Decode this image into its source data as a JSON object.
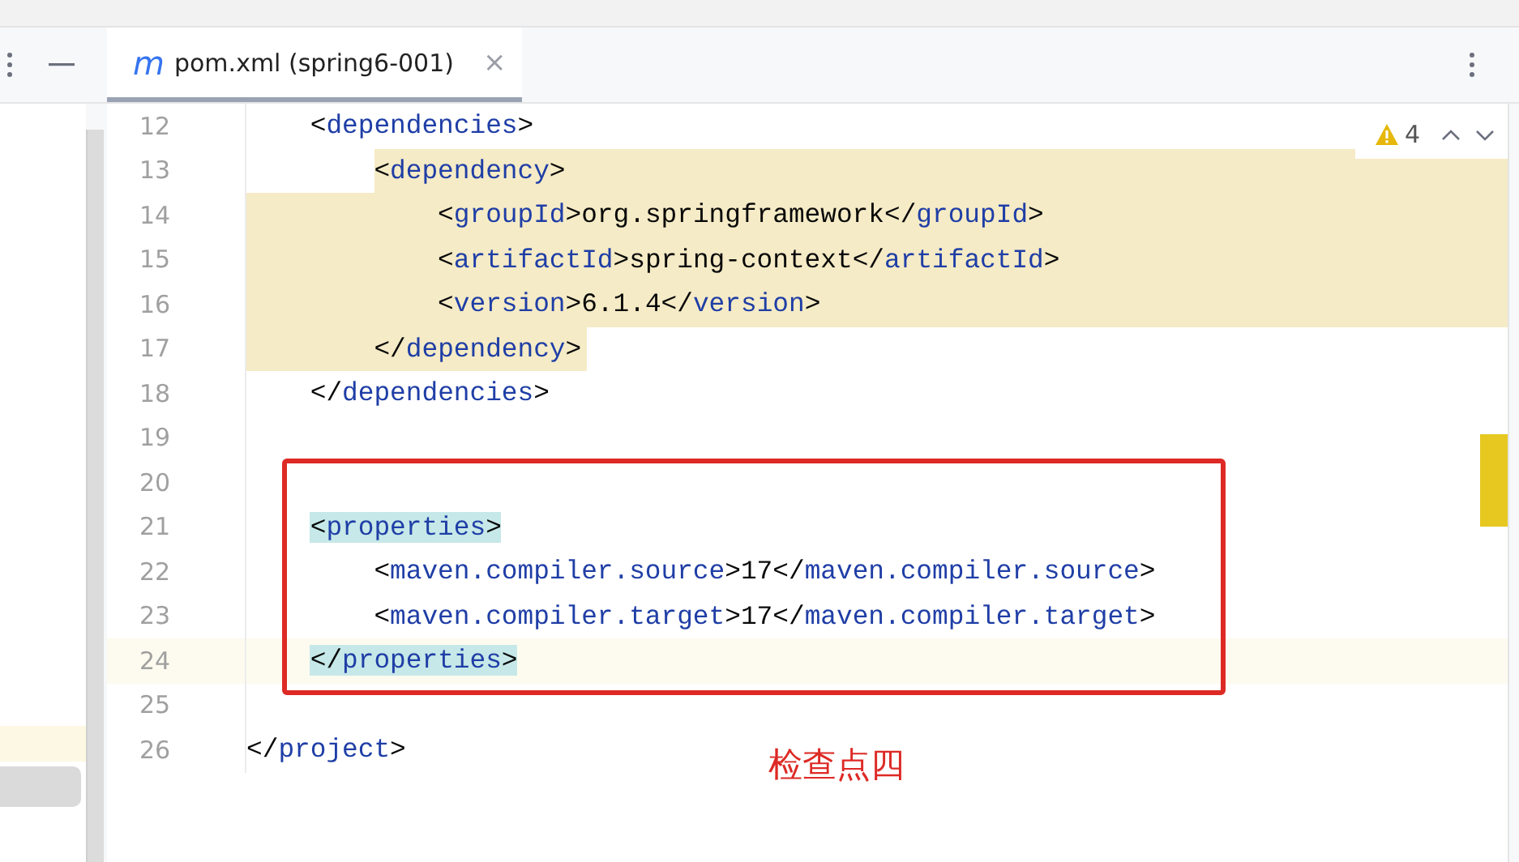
{
  "tab": {
    "icon_letter": "m",
    "label": "pom.xml (spring6-001)",
    "close": "×",
    "selected": true
  },
  "inspection": {
    "count": "4"
  },
  "lines": [
    {
      "number": "12",
      "kind": "plain",
      "text": "    <dependencies>",
      "current": false,
      "matched": false
    },
    {
      "number": "13",
      "kind": "band-start",
      "text": "        <dependency>",
      "current": false,
      "matched": false
    },
    {
      "number": "14",
      "kind": "band",
      "text": "            <groupId>org.springframework</groupId>",
      "current": false,
      "matched": false
    },
    {
      "number": "15",
      "kind": "band",
      "text": "            <artifactId>spring-context</artifactId>",
      "current": false,
      "matched": false
    },
    {
      "number": "16",
      "kind": "band",
      "text": "            <version>6.1.4</version>",
      "current": false,
      "matched": false
    },
    {
      "number": "17",
      "kind": "band-end",
      "text": "        </dependency>",
      "current": false,
      "matched": false
    },
    {
      "number": "18",
      "kind": "plain",
      "text": "    </dependencies>",
      "current": false,
      "matched": false
    },
    {
      "number": "19",
      "kind": "plain",
      "current": false
    },
    {
      "number": "20",
      "kind": "plain",
      "current": false
    },
    {
      "number": "21",
      "kind": "plain",
      "text": "    <properties>",
      "current": false,
      "matched": true
    },
    {
      "number": "22",
      "kind": "plain",
      "text": "        <maven.compiler.source>17</maven.compiler.source>",
      "current": false,
      "matched": false
    },
    {
      "number": "23",
      "kind": "plain",
      "text": "        <maven.compiler.target>17</maven.compiler.target>",
      "current": false,
      "matched": false
    },
    {
      "number": "24",
      "kind": "plain",
      "text": "    </properties>",
      "current": true,
      "matched": true
    },
    {
      "number": "25",
      "kind": "plain",
      "current": false
    },
    {
      "number": "26",
      "kind": "plain",
      "text": "</project>",
      "current": false,
      "matched": false
    }
  ],
  "annotation": {
    "caption": "检查点四"
  }
}
